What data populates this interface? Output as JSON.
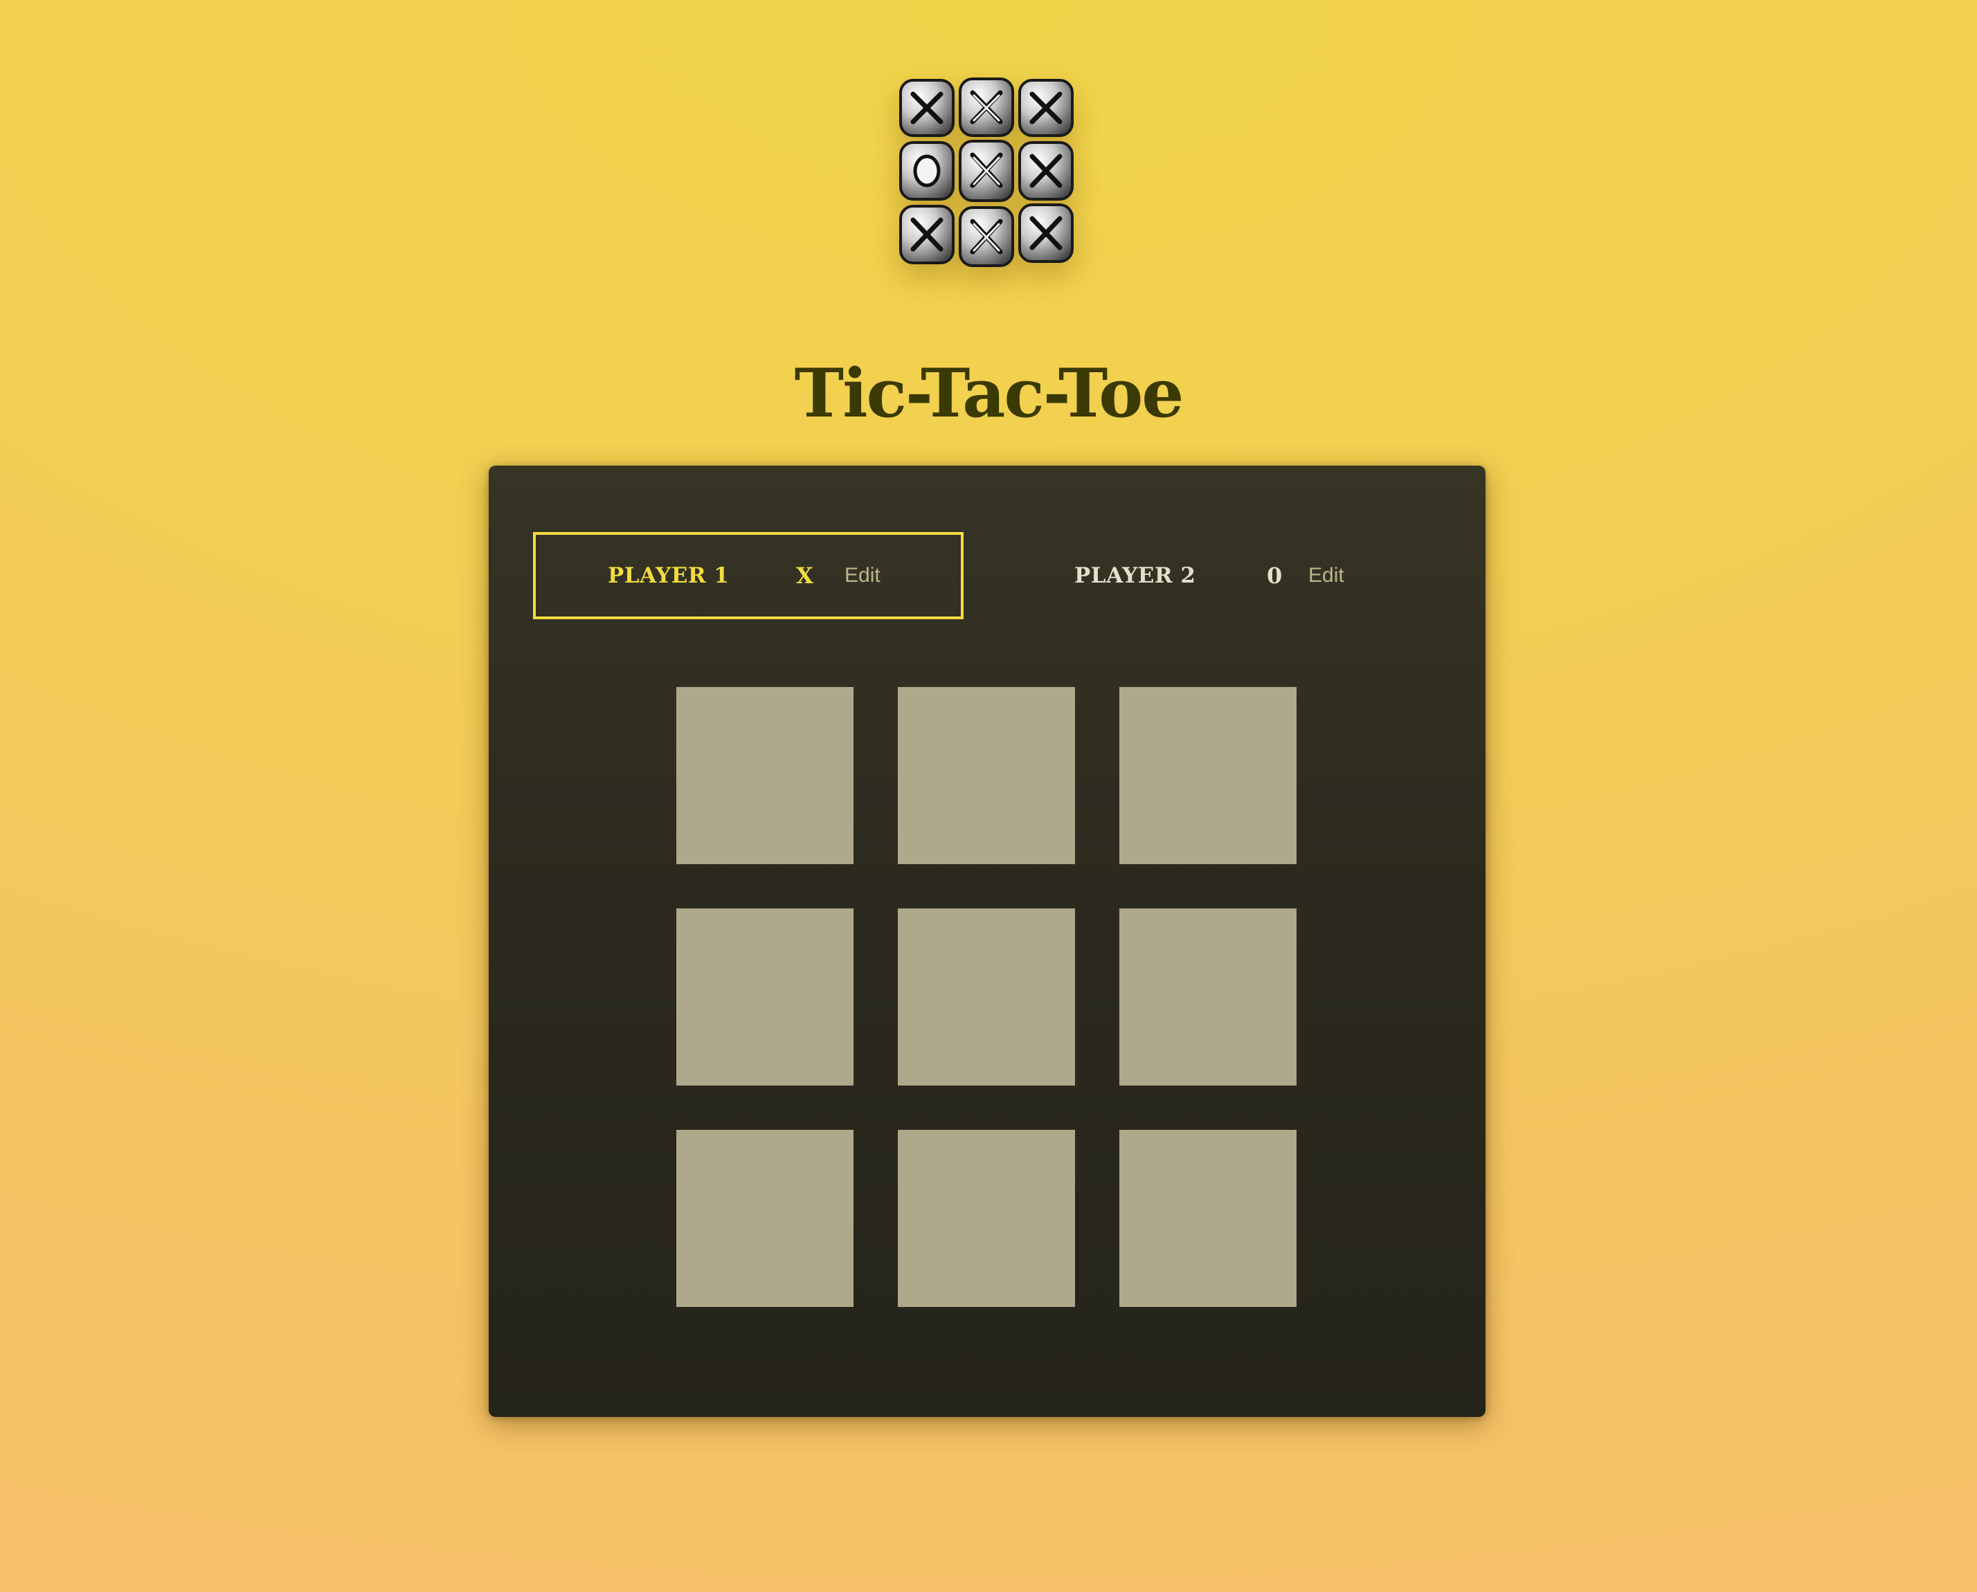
{
  "app": {
    "title": "Tic-Tac-Toe",
    "logo_icon": "tic-tac-toe-logo-icon"
  },
  "players": [
    {
      "name": "PLAYER 1",
      "symbol": "X",
      "edit_label": "Edit",
      "active": true
    },
    {
      "name": "PLAYER 2",
      "symbol": "0",
      "edit_label": "Edit",
      "active": false
    }
  ],
  "board": {
    "cells": [
      "",
      "",
      "",
      "",
      "",
      "",
      "",
      "",
      ""
    ]
  },
  "colors": {
    "background": "#f2cf52",
    "panel": "#2c2a1e",
    "active_accent": "#f2dc3f",
    "cell": "#aea98a",
    "title": "#3b3a05",
    "edit": "#bdb58d"
  }
}
